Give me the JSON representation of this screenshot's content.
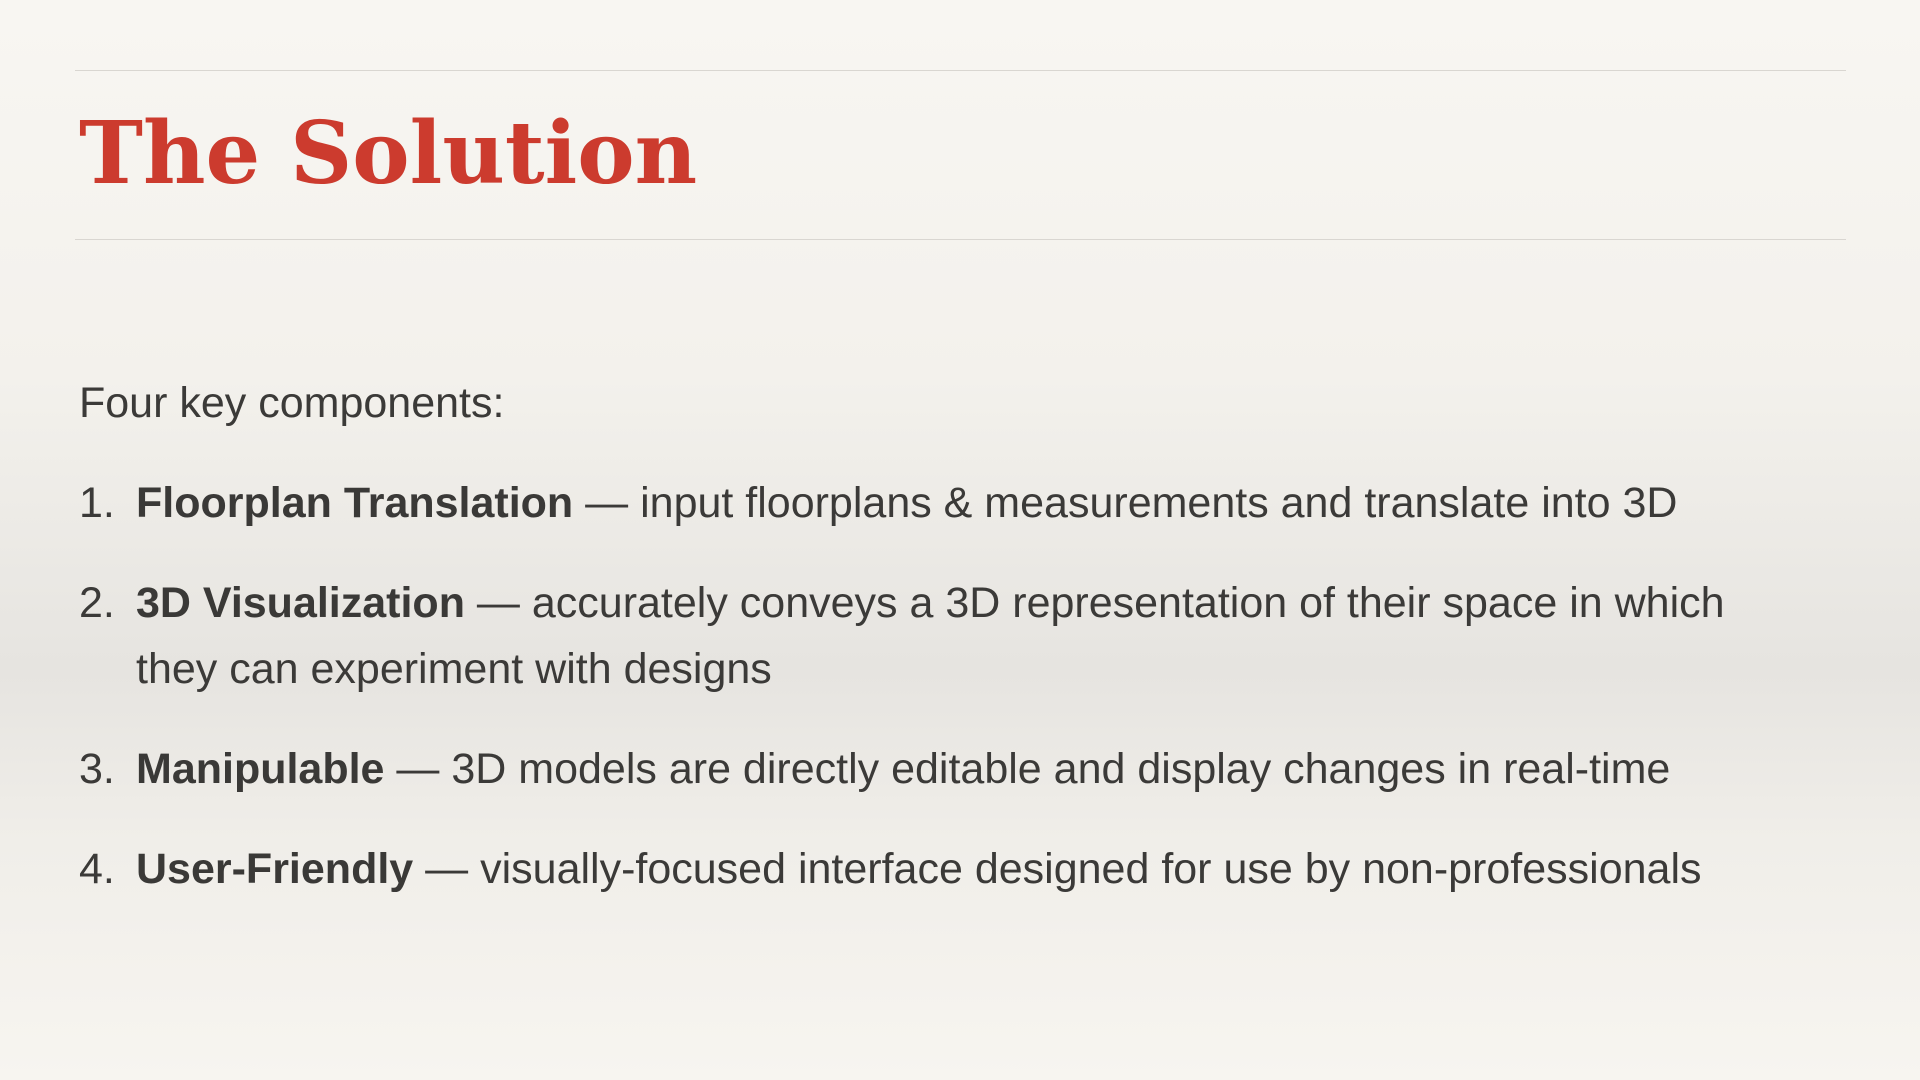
{
  "slide": {
    "title": "The Solution",
    "intro": "Four key components:",
    "items": [
      {
        "number": "1.",
        "term": "Floorplan Translation",
        "description": " — input floorplans & measurements and translate into 3D"
      },
      {
        "number": "2.",
        "term": "3D Visualization",
        "description": " — accurately conveys a 3D representation of their space in which they can experiment with designs"
      },
      {
        "number": "3.",
        "term": "Manipulable",
        "description": " — 3D models are directly editable and display changes in real-time"
      },
      {
        "number": "4.",
        "term": "User-Friendly",
        "description": " — visually-focused interface designed for use by non-professionals"
      }
    ]
  },
  "colors": {
    "title": "#cc3b2e",
    "text": "#3b3a38",
    "rule": "#d9d6d1"
  }
}
